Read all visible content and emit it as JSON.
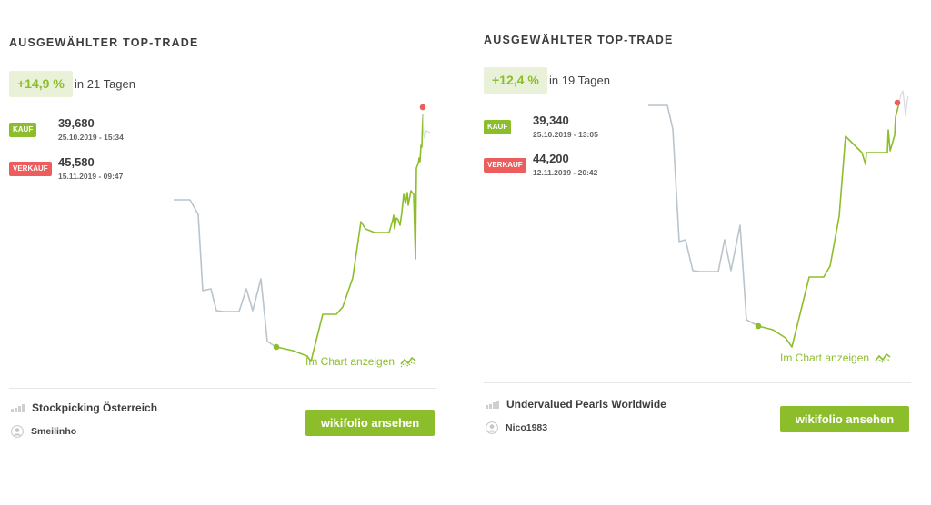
{
  "cards": [
    {
      "title": "AUSGEWÄHLTER TOP-TRADE",
      "performance": "+14,9 %",
      "period": "in 21 Tagen",
      "buy": {
        "tag": "KAUF",
        "price": "39,680",
        "date": "25.10.2019 - 15:34"
      },
      "sell": {
        "tag": "VERKAUF",
        "price": "45,580",
        "date": "15.11.2019 - 09:47"
      },
      "chart_link": "Im Chart anzeigen",
      "wikifolio_name": "Stockpicking Österreich",
      "trader_name": "Smeilinho",
      "button_label": "wikifolio ansehen"
    },
    {
      "title": "AUSGEWÄHLTER TOP-TRADE",
      "performance": "+12,4 %",
      "period": "in 19 Tagen",
      "buy": {
        "tag": "KAUF",
        "price": "39,340",
        "date": "25.10.2019 - 13:05"
      },
      "sell": {
        "tag": "VERKAUF",
        "price": "44,200",
        "date": "12.11.2019 - 20:42"
      },
      "chart_link": "Im Chart anzeigen",
      "wikifolio_name": "Undervalued Pearls Worldwide",
      "trader_name": "Nico1983",
      "button_label": "wikifolio ansehen"
    }
  ],
  "icons": {
    "chart_link_icon": "trend-chart-icon",
    "wikifolio_icon": "bar-chart-icon",
    "trader_icon": "user-avatar-icon"
  },
  "colors": {
    "accent": "#8cbe2b",
    "sell": "#ee5d5d",
    "badge_bg": "#e9f2d8",
    "pre_trade_line": "#b9c4cc",
    "after_trade_line": "#d5dadf"
  }
}
